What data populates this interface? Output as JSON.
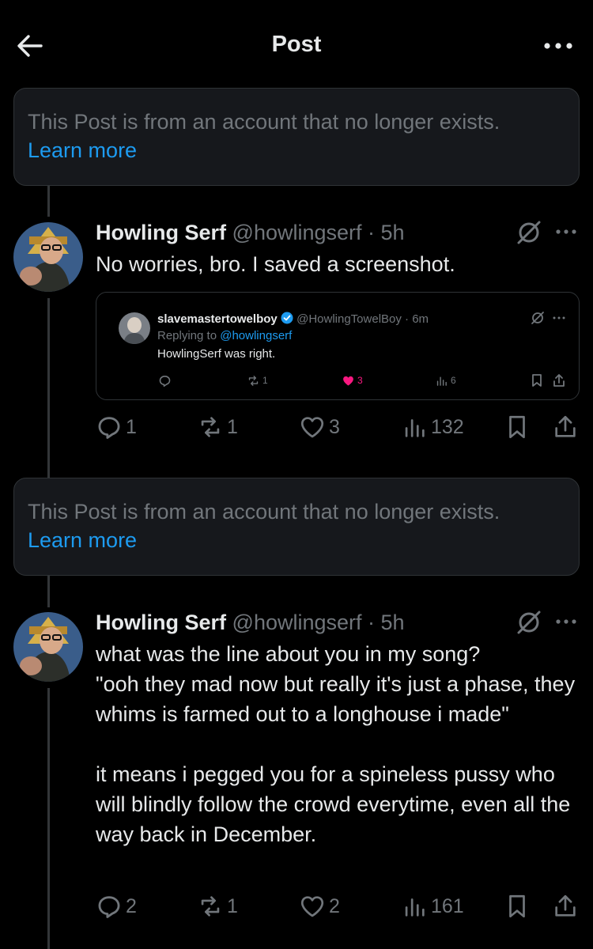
{
  "header": {
    "title": "Post",
    "back_icon": "arrow-left-icon",
    "more_icon": "more-horizontal-icon"
  },
  "notices": [
    {
      "text": "This Post is from an account that no longer exists.",
      "link": "Learn more"
    },
    {
      "text": "This Post is from an account that no longer exists.",
      "link": "Learn more"
    }
  ],
  "posts": [
    {
      "name": "Howling Serf",
      "handle": "@howlingserf",
      "time": "· 5h",
      "text": "No worries, bro. I saved a screenshot.",
      "counts": {
        "replies": "1",
        "reposts": "1",
        "likes": "3",
        "views": "132"
      }
    },
    {
      "name": "Howling Serf",
      "handle": "@howlingserf",
      "time": "· 5h",
      "text": "what was the line about you in my song?\n\"ooh they mad now but really it's just a phase, they whims is farmed out to a longhouse i made\"\n\nit means i pegged you for a spineless pussy who will blindly follow the crowd everytime, even all the way back in December.",
      "counts": {
        "replies": "2",
        "reposts": "1",
        "likes": "2",
        "views": "161"
      }
    }
  ],
  "quote": {
    "name": "slavemastertowelboy",
    "handle": "@HowlingTowelBoy",
    "time": "· 6m",
    "replying_prefix": "Replying to",
    "replying_handle": "@howlingserf",
    "text": "HowlingSerf was right.",
    "counts": {
      "reposts": "1",
      "likes": "3",
      "views": "6"
    }
  },
  "colors": {
    "background": "#000000",
    "accent": "#1d9bf0",
    "muted": "#71767b",
    "like": "#f91880",
    "verified": "#1d9bf0"
  }
}
